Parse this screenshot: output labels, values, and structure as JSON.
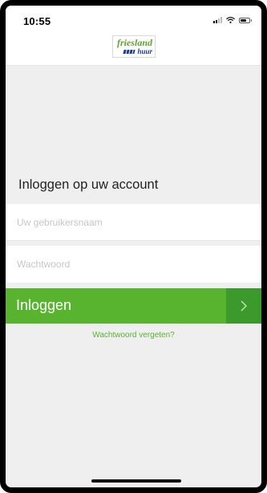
{
  "status_bar": {
    "time": "10:55",
    "icons": [
      "signal-icon",
      "wifi-icon",
      "battery-icon"
    ]
  },
  "header": {
    "logo_top": "friesland",
    "logo_sub": "huur",
    "logo_colors": {
      "green": "#5aa72e",
      "blue": "#1c3d8c"
    }
  },
  "login": {
    "title": "Inloggen op uw account",
    "username_placeholder": "Uw gebruikersnaam",
    "username_value": "",
    "password_placeholder": "Wachtwoord",
    "password_value": "",
    "button_label": "Inloggen",
    "button_icon": "chevron-right-icon",
    "forgot_label": "Wachtwoord vergeten?"
  },
  "colors": {
    "accent": "#58b32f",
    "accent_dark": "#3c9a2d",
    "background": "#efefef"
  }
}
